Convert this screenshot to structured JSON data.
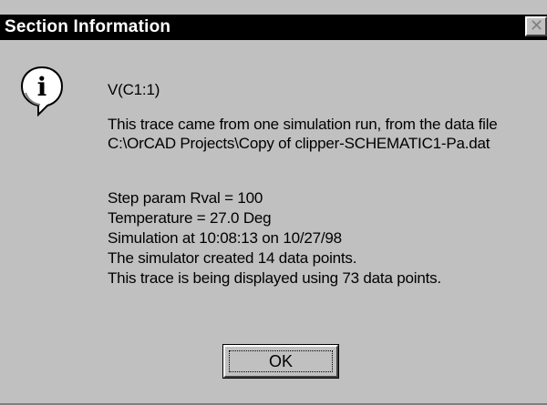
{
  "window": {
    "title": "Section Information",
    "close_glyph": "✕",
    "background_color": "#c0c0c0",
    "titlebar_color": "#000000"
  },
  "icon": {
    "name": "info-icon",
    "glyph": "i"
  },
  "message": {
    "trace_name": "V(C1:1)",
    "source_line_1": "This trace came from one simulation run, from the data file",
    "source_line_2": "C:\\OrCAD Projects\\Copy of clipper-SCHEMATIC1-Pa.dat",
    "step_param": "Step param Rval = 100",
    "temperature": "Temperature = 27.0 Deg",
    "simulation_time": "Simulation at 10:08:13 on 10/27/98",
    "data_points_created": "The simulator created 14 data points.",
    "data_points_displayed": "This trace is being displayed using 73 data points."
  },
  "buttons": {
    "ok_label": "OK"
  }
}
